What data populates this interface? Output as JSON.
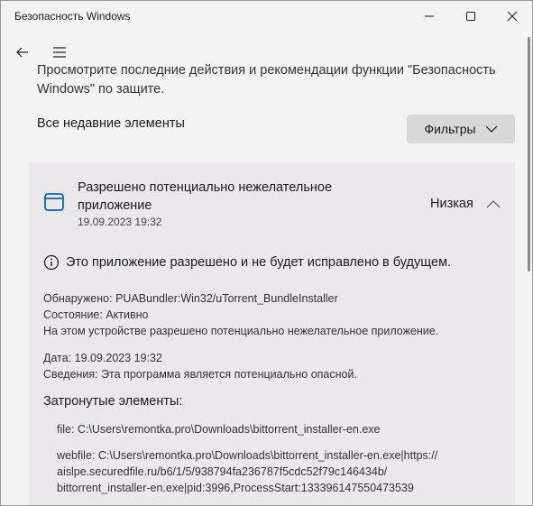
{
  "window": {
    "title": "Безопасность Windows"
  },
  "intro": "Просмотрите последние действия и рекомендации функции \"Безопасность Windows\" по защите.",
  "recent_label": "Все недавние элементы",
  "filters_label": "Фильтры",
  "item": {
    "title": "Разрешено потенциально нежелательное приложение",
    "date": "19.09.2023 19:32",
    "severity": "Низкая",
    "info": "Это приложение разрешено и не будет исправлено в будущем.",
    "detected_label": "Обнаружено:",
    "detected_value": "PUABundler:Win32/uTorrent_BundleInstaller",
    "status_label": "Состояние:",
    "status_value": "Активно",
    "status_note": "На этом устройстве разрешено потенциально нежелательное приложение.",
    "date_label": "Дата:",
    "date_value": "19.09.2023 19:32",
    "details_label": "Сведения:",
    "details_value": "Эта программа является потенциально опасной.",
    "affected_heading": "Затронутые элементы:",
    "affected_file": "file: C:\\Users\\remontka.pro\\Downloads\\bittorrent_installer-en.exe",
    "affected_webfile_1": "webfile: C:\\Users\\remontka.pro\\Downloads\\bittorrent_installer-en.exe|https://",
    "affected_webfile_2": "aislpe.securedfile.ru/b6/1/5/938794fa236787f5cdc52f79c146434b/",
    "affected_webfile_3": "bittorrent_installer-en.exe|pid:3996,ProcessStart:133396147550473539"
  },
  "icons": {
    "back": "back-arrow-icon",
    "menu": "hamburger-menu-icon",
    "filter_chevron": "chevron-down-icon",
    "app": "app-window-icon",
    "collapse": "chevron-up-icon",
    "info": "info-icon"
  }
}
